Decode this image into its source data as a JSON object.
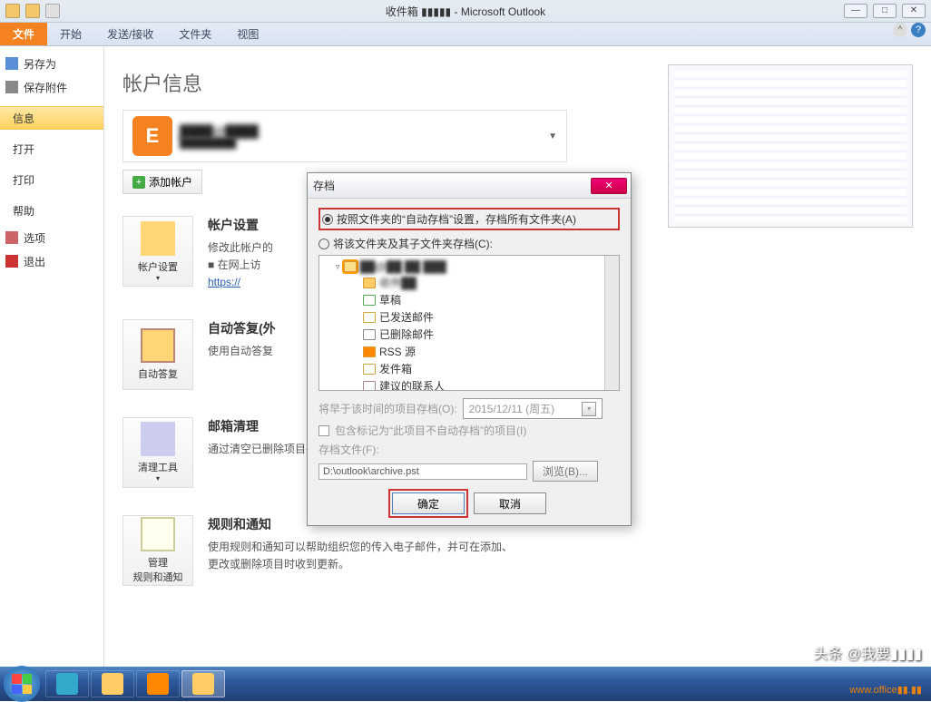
{
  "titlebar": {
    "title": "收件箱 ▮▮▮▮▮ - Microsoft Outlook"
  },
  "ribbon": {
    "tabs": [
      "文件",
      "开始",
      "发送/接收",
      "文件夹",
      "视图"
    ]
  },
  "backstage_left": {
    "save_as": "另存为",
    "save_attach": "保存附件",
    "info": "信息",
    "open": "打开",
    "print": "打印",
    "help": "帮助",
    "options": "选项",
    "exit": "退出"
  },
  "backstage": {
    "title": "帐户信息",
    "add_account": "添加帐户",
    "acct_settings": {
      "btn": "帐户设置",
      "title": "帐户设置",
      "desc": "修改此帐户的",
      "link_pre": "在网上访",
      "link": "https://"
    },
    "auto_reply": {
      "btn": "自动答复",
      "title": "自动答复(外",
      "desc": "使用自动答复"
    },
    "cleanup": {
      "btn": "清理工具",
      "title": "邮箱清理",
      "desc": "通过清空已删除项目并存档，来管理您的邮箱大小。"
    },
    "rules": {
      "btn": "管理\n规则和通知",
      "title": "规则和通知",
      "desc1": "使用规则和通知可以帮助组织您的传入电子邮件，并可在添加、",
      "desc2": "更改或删除项目时收到更新。"
    }
  },
  "dialog": {
    "title": "存档",
    "radio1": "按照文件夹的“自动存档”设置，存档所有文件夹(A)",
    "radio2": "将该文件夹及其子文件夹存档(C):",
    "tree": {
      "drafts": "草稿",
      "sent": "已发送邮件",
      "deleted": "已删除邮件",
      "rss": "RSS 源",
      "outbox": "发件箱",
      "contacts": "建议的联系人"
    },
    "date_label": "将早于该时间的项目存档(O):",
    "date_value": "2015/12/11 (周五)",
    "checkbox": "包含标记为“此项目不自动存档”的项目(I)",
    "file_label": "存档文件(F):",
    "file_path": "D:\\outlook\\archive.pst",
    "browse": "浏览(B)...",
    "ok": "确定",
    "cancel": "取消"
  },
  "watermark": "头条 @我要▮▮▮▮",
  "watermark2": "www.office▮▮.▮▮"
}
